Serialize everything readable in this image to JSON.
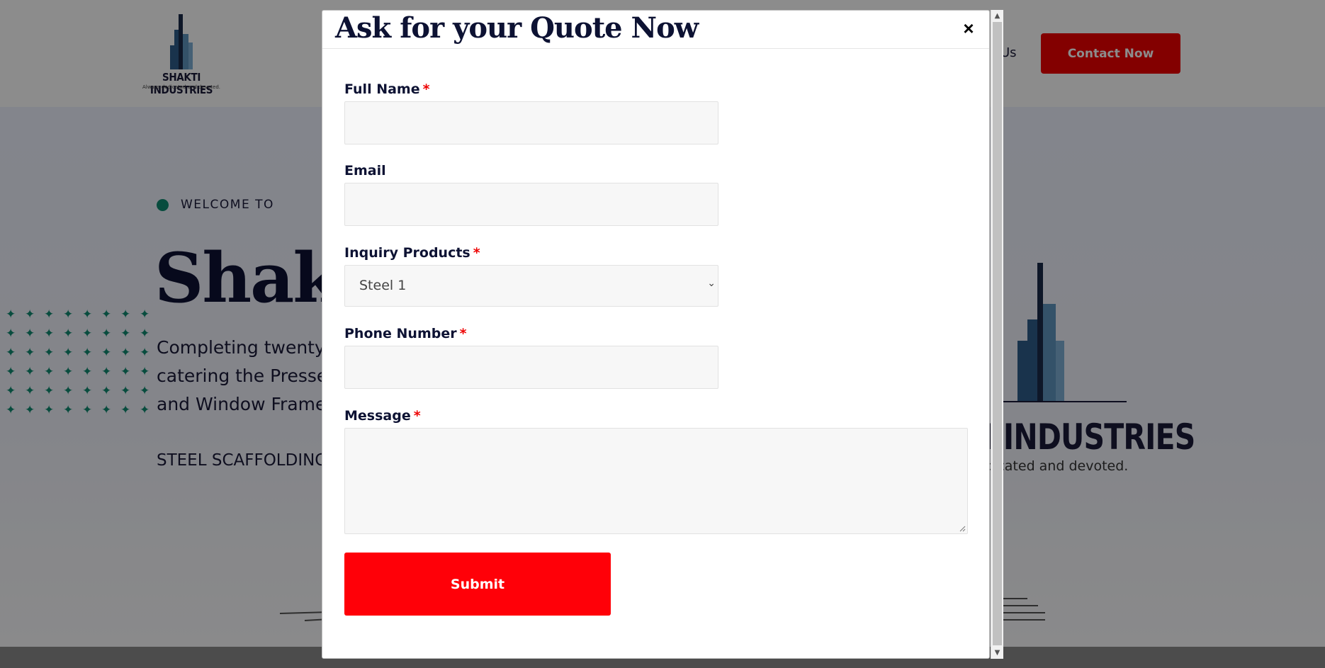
{
  "site": {
    "logo_name": "SHAKTI INDUSTRIES",
    "logo_tagline": "Always dedicated and devoted.",
    "nav_partial": "Us",
    "contact_button": "Contact Now"
  },
  "hero": {
    "welcome": "WELCOME TO",
    "title_partial": "Shakt",
    "description_lines": [
      "Completing twenty",
      "catering the Presse",
      "and Window Frame"
    ],
    "subline_partial": "STEEL SCAFFOLDING",
    "logo_name_partial": "I INDUSTRIES",
    "logo_tagline_partial": "dicated and devoted."
  },
  "modal": {
    "title": "Ask for your Quote Now",
    "close_symbol": "×",
    "fields": {
      "full_name": {
        "label": "Full Name",
        "required": "*",
        "value": ""
      },
      "email": {
        "label": "Email",
        "value": ""
      },
      "inquiry_products": {
        "label": "Inquiry Products",
        "required": "*",
        "selected": "Steel 1"
      },
      "phone_number": {
        "label": "Phone Number",
        "required": "*",
        "value": ""
      },
      "message": {
        "label": "Message",
        "required": "*",
        "value": ""
      }
    },
    "submit_label": "Submit"
  },
  "colors": {
    "accent_red": "#ff0008",
    "navy": "#0d1233",
    "teal": "#0f8b71"
  },
  "icons": {
    "close": "close-icon",
    "select_arrow": "chevron-down-icon",
    "scroll_up": "scroll-up-arrow-icon",
    "scroll_down": "scroll-down-arrow-icon"
  }
}
